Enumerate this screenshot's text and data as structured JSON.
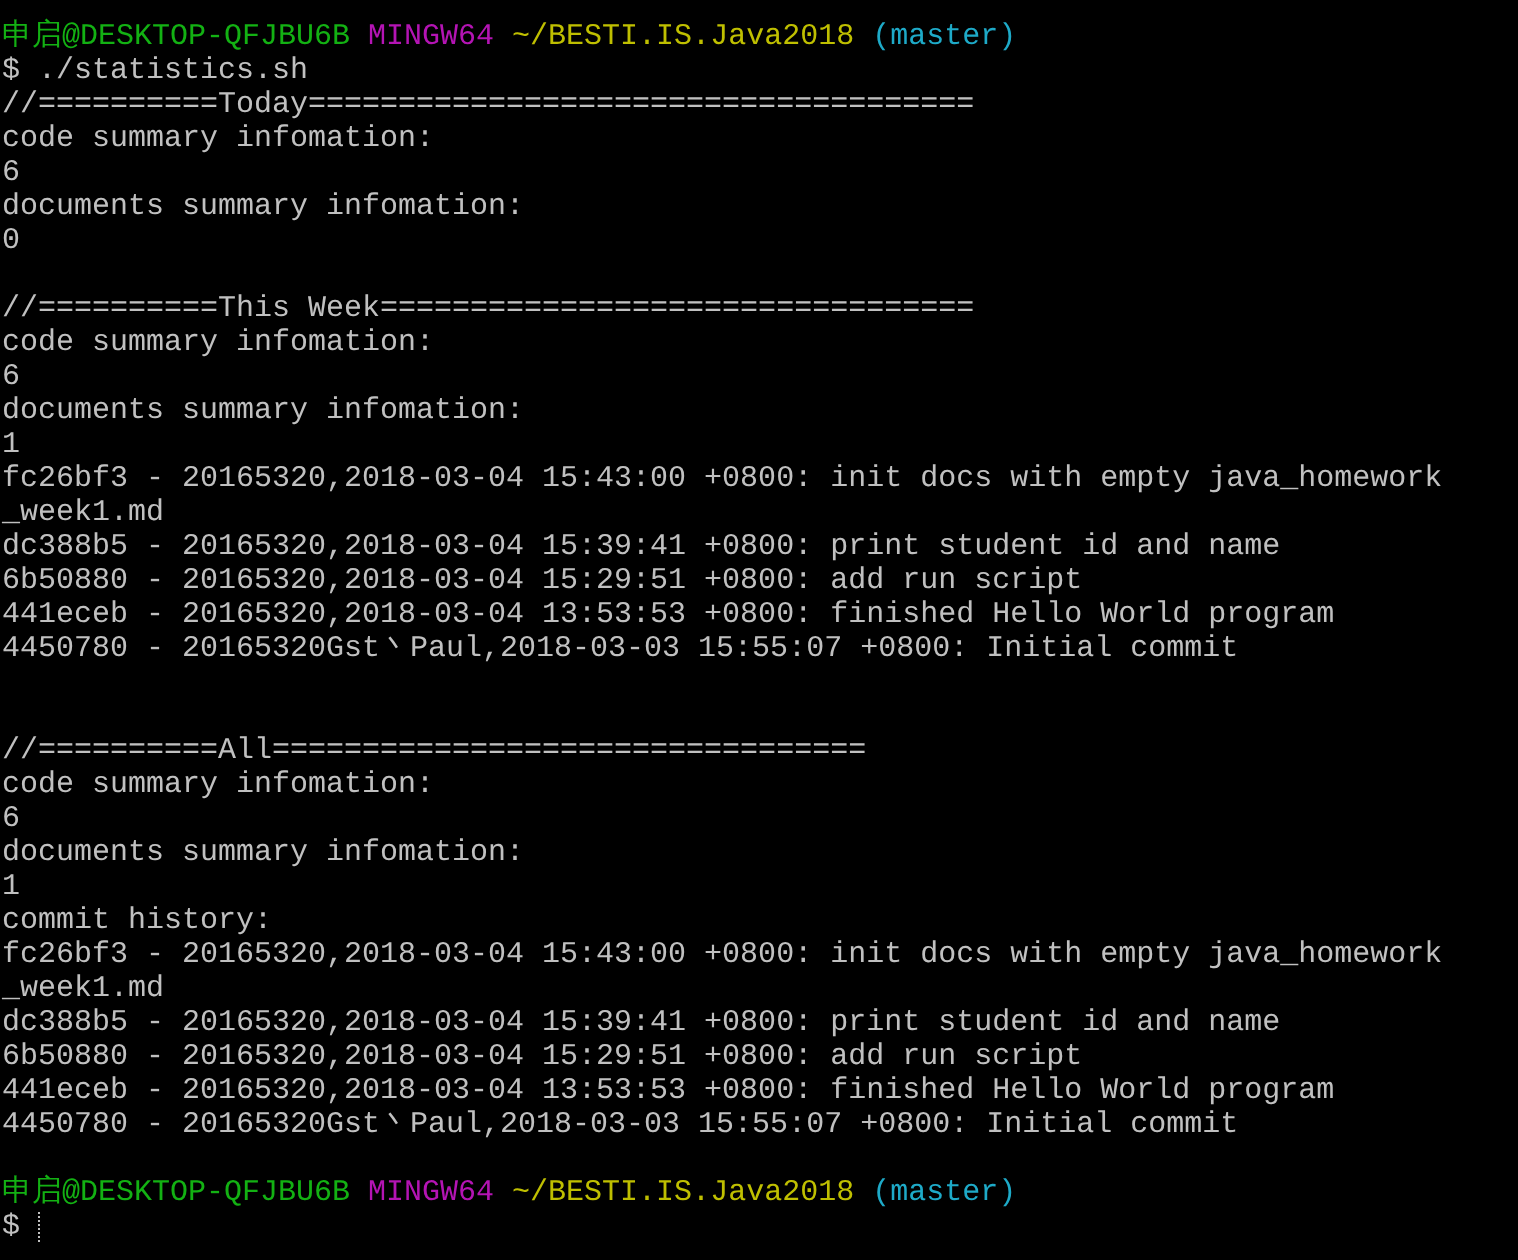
{
  "terminal": {
    "lines": [
      {
        "kind": "prompt",
        "user": "申启@DESKTOP-QFJBU6B",
        "system": "MINGW64",
        "path": "~/BESTI.IS.Java2018",
        "branch": "(master)"
      },
      {
        "kind": "command",
        "symbol": "$",
        "command": "./statistics.sh"
      },
      {
        "kind": "output",
        "text": "//==========Today====================================="
      },
      {
        "kind": "output",
        "text": "code summary infomation:"
      },
      {
        "kind": "output",
        "text": "6"
      },
      {
        "kind": "output",
        "text": "documents summary infomation:"
      },
      {
        "kind": "output",
        "text": "0"
      },
      {
        "kind": "blank"
      },
      {
        "kind": "output",
        "text": "//==========This Week================================="
      },
      {
        "kind": "output",
        "text": "code summary infomation:"
      },
      {
        "kind": "output",
        "text": "6"
      },
      {
        "kind": "output",
        "text": "documents summary infomation:"
      },
      {
        "kind": "output",
        "text": "1"
      },
      {
        "kind": "output",
        "text": "fc26bf3 - 20165320,2018-03-04 15:43:00 +0800: init docs with empty java_homework"
      },
      {
        "kind": "output",
        "text": "_week1.md"
      },
      {
        "kind": "output",
        "text": "dc388b5 - 20165320,2018-03-04 15:39:41 +0800: print student id and name"
      },
      {
        "kind": "output",
        "text": "6b50880 - 20165320,2018-03-04 15:29:51 +0800: add run script"
      },
      {
        "kind": "output",
        "text": "441eceb - 20165320,2018-03-04 13:53:53 +0800: finished Hello World program"
      },
      {
        "kind": "output",
        "text": "4450780 - 20165320Gst丶Paul,2018-03-03 15:55:07 +0800: Initial commit"
      },
      {
        "kind": "blank"
      },
      {
        "kind": "blank"
      },
      {
        "kind": "output",
        "text": "//==========All================================="
      },
      {
        "kind": "output",
        "text": "code summary infomation:"
      },
      {
        "kind": "output",
        "text": "6"
      },
      {
        "kind": "output",
        "text": "documents summary infomation:"
      },
      {
        "kind": "output",
        "text": "1"
      },
      {
        "kind": "output",
        "text": "commit history:"
      },
      {
        "kind": "output",
        "text": "fc26bf3 - 20165320,2018-03-04 15:43:00 +0800: init docs with empty java_homework"
      },
      {
        "kind": "output",
        "text": "_week1.md"
      },
      {
        "kind": "output",
        "text": "dc388b5 - 20165320,2018-03-04 15:39:41 +0800: print student id and name"
      },
      {
        "kind": "output",
        "text": "6b50880 - 20165320,2018-03-04 15:29:51 +0800: add run script"
      },
      {
        "kind": "output",
        "text": "441eceb - 20165320,2018-03-04 13:53:53 +0800: finished Hello World program"
      },
      {
        "kind": "output",
        "text": "4450780 - 20165320Gst丶Paul,2018-03-03 15:55:07 +0800: Initial commit"
      },
      {
        "kind": "blank"
      },
      {
        "kind": "prompt",
        "user": "申启@DESKTOP-QFJBU6B",
        "system": "MINGW64",
        "path": "~/BESTI.IS.Java2018",
        "branch": "(master)"
      },
      {
        "kind": "input",
        "symbol": "$"
      }
    ]
  }
}
